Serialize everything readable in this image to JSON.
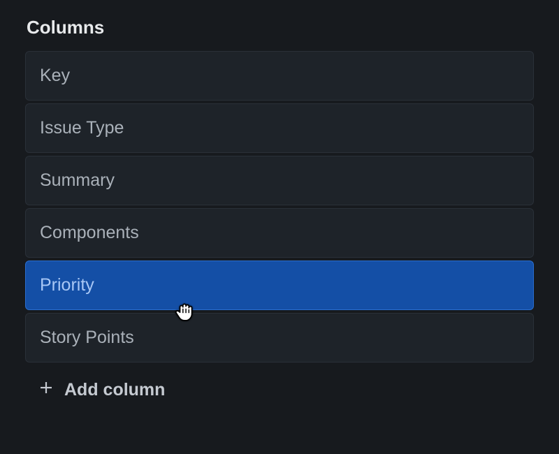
{
  "section": {
    "title": "Columns"
  },
  "columns": [
    {
      "label": "Key",
      "selected": false
    },
    {
      "label": "Issue Type",
      "selected": false
    },
    {
      "label": "Summary",
      "selected": false
    },
    {
      "label": "Components",
      "selected": false
    },
    {
      "label": "Priority",
      "selected": true
    },
    {
      "label": "Story Points",
      "selected": false
    }
  ],
  "add_column": {
    "label": "Add column"
  },
  "icons": {
    "plus": "plus-icon",
    "grab_cursor": "grab-cursor-icon"
  },
  "colors": {
    "background": "#171a1e",
    "item_bg": "#1e2329",
    "item_text": "#aab1b9",
    "selected_bg": "#144fa6",
    "selected_text": "#a8c7f5",
    "heading_text": "#e8eaec"
  }
}
